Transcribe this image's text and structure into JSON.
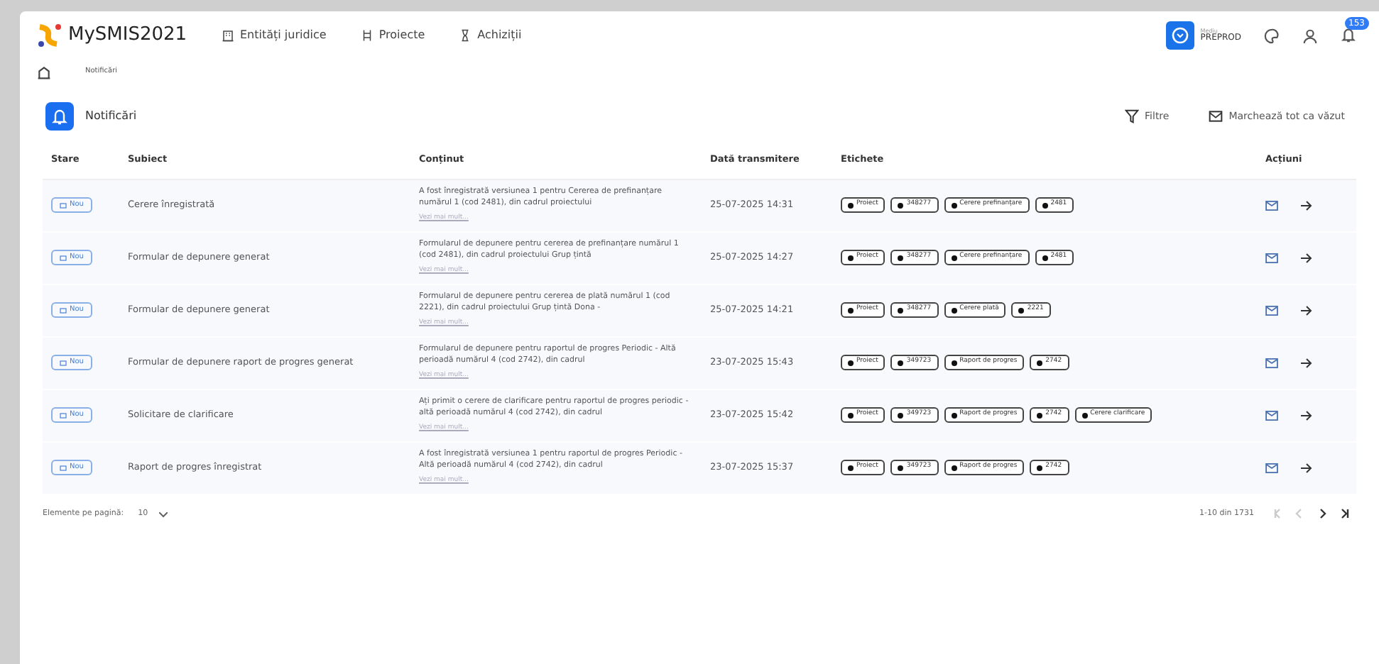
{
  "header": {
    "logo_text": "MySMIS2021",
    "nav": [
      {
        "label": "Entități juridice"
      },
      {
        "label": "Proiecte"
      },
      {
        "label": "Achiziții"
      }
    ],
    "environment": {
      "caption": "Mediu",
      "name": "PREPROD"
    },
    "notifications_count": "153"
  },
  "breadcrumb": [
    "Notificări"
  ],
  "page": {
    "title": "Notificări",
    "filter_label": "Filtre",
    "mark_all_label": "Marchează tot ca văzut"
  },
  "table": {
    "columns": [
      "Stare",
      "Subiect",
      "Conținut",
      "Dată transmitere",
      "Etichete",
      "Acțiuni"
    ],
    "rows": [
      {
        "status": "Nou",
        "more": "Vezi mai mult...",
        "subject": "Cerere înregistrată",
        "content": "A fost înregistrată versiunea 1 pentru Cererea de prefinanțare numărul 1 (cod 2481), din cadrul proiectului",
        "date": "25-07-2025 14:31",
        "tags": [
          "Proiect",
          "348277",
          "Cerere prefinanțare",
          "2481"
        ]
      },
      {
        "status": "Nou",
        "more": "Vezi mai mult...",
        "subject": "Formular de depunere generat",
        "content": "Formularul de depunere pentru cererea de prefinanțare numărul 1 (cod 2481), din cadrul proiectului Grup țintă",
        "date": "25-07-2025 14:27",
        "tags": [
          "Proiect",
          "348277",
          "Cerere prefinanțare",
          "2481"
        ]
      },
      {
        "status": "Nou",
        "more": "Vezi mai mult...",
        "subject": "Formular de depunere generat",
        "content": "Formularul de depunere pentru cererea de plată numărul 1 (cod 2221), din cadrul proiectului Grup țintă Dona -",
        "date": "25-07-2025 14:21",
        "tags": [
          "Proiect",
          "348277",
          "Cerere plată",
          "2221"
        ]
      },
      {
        "status": "Nou",
        "more": "Vezi mai mult...",
        "subject": "Formular de depunere raport de progres generat",
        "content": "Formularul de depunere pentru raportul de progres Periodic - Altă perioadă numărul 4 (cod 2742), din cadrul",
        "date": "23-07-2025 15:43",
        "tags": [
          "Proiect",
          "349723",
          "Raport de progres",
          "2742"
        ]
      },
      {
        "status": "Nou",
        "more": "Vezi mai mult...",
        "subject": "Solicitare de clarificare",
        "content": "Ați primit o cerere de clarificare pentru raportul de progres periodic - altă perioadă numărul 4 (cod 2742), din cadrul",
        "date": "23-07-2025 15:42",
        "tags": [
          "Proiect",
          "349723",
          "Raport de progres",
          "2742",
          "Cerere clarificare"
        ]
      },
      {
        "status": "Nou",
        "more": "Vezi mai mult...",
        "subject": "Raport de progres înregistrat",
        "content": "A fost înregistrată versiunea 1 pentru raportul de progres Periodic - Altă perioadă numărul 4 (cod 2742), din cadrul",
        "date": "23-07-2025 15:37",
        "tags": [
          "Proiect",
          "349723",
          "Raport de progres",
          "2742"
        ]
      }
    ]
  },
  "pagination": {
    "per_page_label": "Elemente pe pagină:",
    "per_page": "10",
    "range": "1-10 din 1731",
    "first_disabled": true,
    "prev_disabled": true
  }
}
